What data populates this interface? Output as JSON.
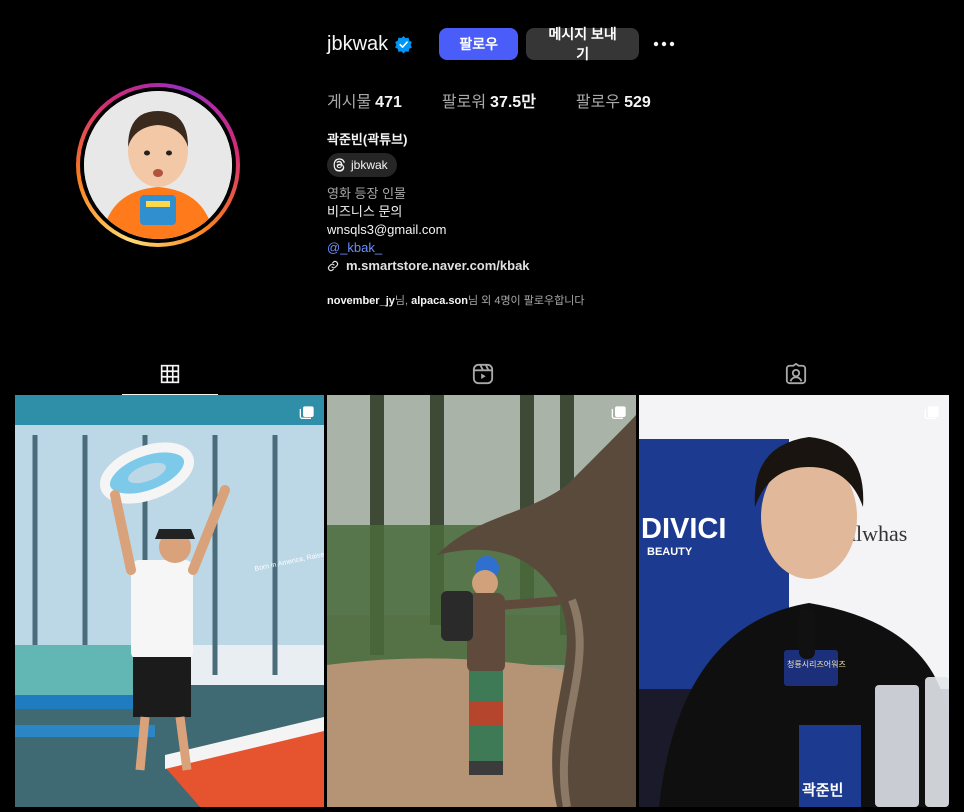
{
  "profile": {
    "username": "jbkwak",
    "verified": true,
    "follow_label": "팔로우",
    "message_label": "메시지 보내기",
    "stats": [
      {
        "label": "게시물",
        "value": "471"
      },
      {
        "label": "팔로워",
        "value": "37.5만"
      },
      {
        "label": "팔로우",
        "value": "529"
      }
    ],
    "full_name": "곽준빈(곽튜브)",
    "threads_handle": "jbkwak",
    "bio": {
      "category": "영화 등장 인물",
      "line1": "비즈니스 문의",
      "email": "wnsqls3@gmail.com",
      "mention": "@_kbak_"
    },
    "link": "m.smartstore.naver.com/kbak",
    "followed_by": {
      "user1": "november_jy",
      "sep": "님, ",
      "user2": "alpaca.son",
      "rest": "님 외 4명이 팔로우합니다"
    }
  },
  "tabs": [
    {
      "icon": "grid-icon",
      "active": true
    },
    {
      "icon": "reels-icon",
      "active": false
    },
    {
      "icon": "tagged-icon",
      "active": false
    }
  ],
  "posts": [
    {
      "scene": "man holding inflatable ring outside diner",
      "multi": true
    },
    {
      "scene": "hiker next to twisted tree in forest",
      "multi": true
    },
    {
      "scene": "man speaking at press event",
      "multi": true
    }
  ],
  "post_texts": {
    "sign1": "Born in America, Raised in Okinawa",
    "brand": "DIVICI",
    "brand_sub": "BEAUTY",
    "brand2": "ulwhas",
    "nameplate": "곽준빈",
    "event": "청룡시리즈어워즈"
  },
  "colors": {
    "follow_button": "#4a5df9",
    "message_button": "#363636",
    "background": "#000000",
    "mention": "#6a8fff"
  }
}
